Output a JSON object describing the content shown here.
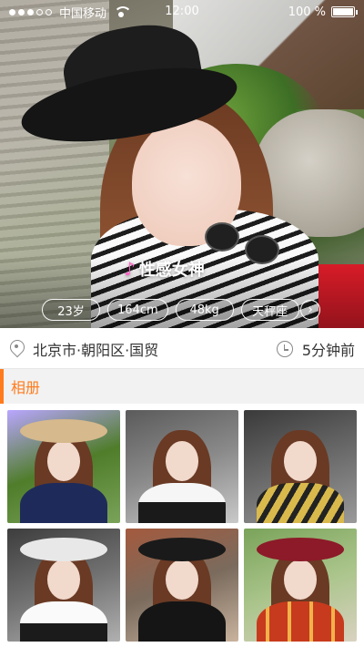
{
  "status_bar": {
    "carrier": "中国移动",
    "time": "12:00",
    "battery": "100 %",
    "battery_level": 1.0
  },
  "profile": {
    "caption": "性感女神",
    "tags": [
      "23岁",
      "164cm",
      "48kg",
      "天秤座"
    ],
    "location": "北京市·朝阳区·国贸",
    "time_ago": "5分钟前"
  },
  "album": {
    "title": "相册",
    "photos": [
      "photo-1",
      "photo-2",
      "photo-3",
      "photo-4",
      "photo-5",
      "photo-6"
    ]
  },
  "colors": {
    "accent": "#ff7b1c",
    "caption_mark": "#ff67c8"
  },
  "icons": {
    "signal": "signal-dots-icon",
    "wifi": "wifi-icon",
    "battery": "battery-icon",
    "location": "location-pin-icon",
    "clock": "clock-icon",
    "more": "chevron-right-icon"
  }
}
